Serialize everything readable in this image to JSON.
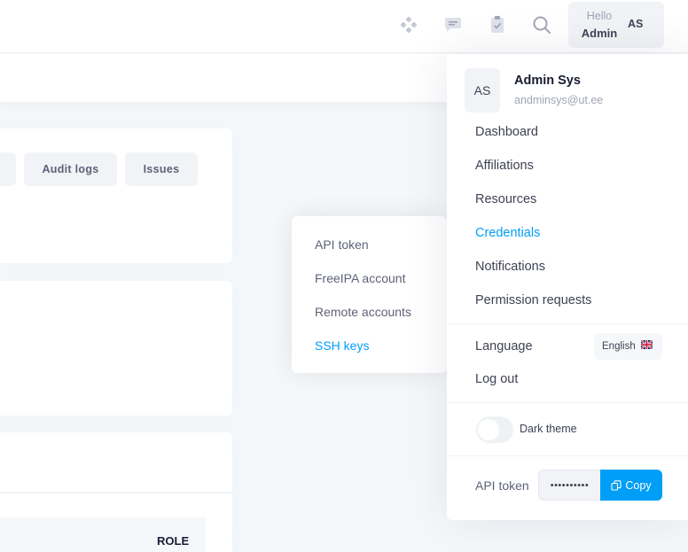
{
  "header": {
    "hello": "Hello",
    "name": "Admin",
    "initials": "AS",
    "icons": [
      "grid-icon",
      "chat-icon",
      "clipboard-check-icon",
      "search-icon"
    ]
  },
  "tabs": [
    "Audit logs",
    "Issues"
  ],
  "table": {
    "role_header": "ROLE"
  },
  "credentials_submenu": {
    "items": [
      "API token",
      "FreeIPA account",
      "Remote accounts",
      "SSH keys"
    ],
    "active": "SSH keys"
  },
  "user_menu": {
    "initials": "AS",
    "name": "Admin Sys",
    "email": "andminsys@ut.ee",
    "items": [
      "Dashboard",
      "Affiliations",
      "Resources",
      "Credentials",
      "Notifications",
      "Permission requests"
    ],
    "active": "Credentials",
    "language_label": "Language",
    "language_value": "English",
    "logout": "Log out",
    "dark_theme_label": "Dark theme",
    "dark_theme_on": false,
    "api_token_label": "API token",
    "api_token_masked": "••••••••••",
    "copy_label": "Copy"
  },
  "colors": {
    "accent": "#009ef7",
    "text": "#3f4254",
    "muted": "#a1a5b7",
    "background": "#f5f8fa"
  }
}
